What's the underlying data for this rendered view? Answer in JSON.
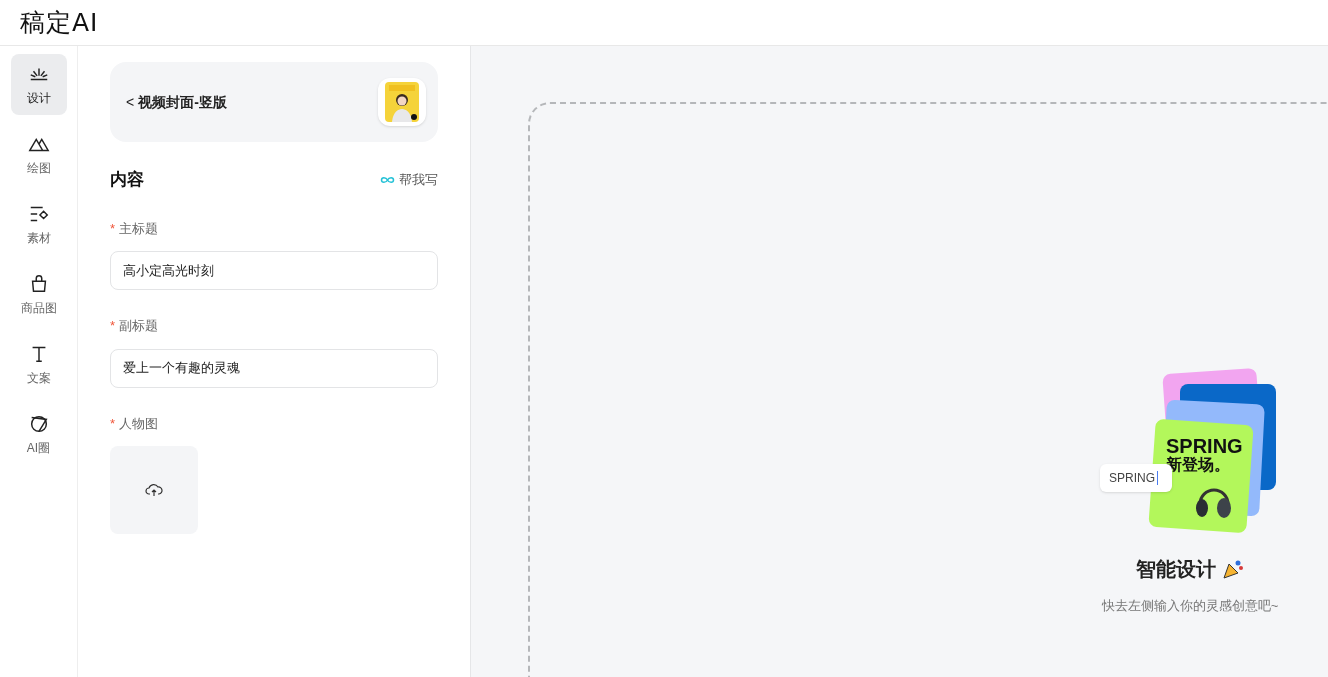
{
  "header": {
    "logo": "稿定AI"
  },
  "nav": [
    {
      "kind": "design",
      "label": "设计",
      "selected": true
    },
    {
      "kind": "draw",
      "label": "绘图",
      "selected": false
    },
    {
      "kind": "material",
      "label": "素材",
      "selected": false
    },
    {
      "kind": "product",
      "label": "商品图",
      "selected": false
    },
    {
      "kind": "text",
      "label": "文案",
      "selected": false
    },
    {
      "kind": "ai",
      "label": "AI圈",
      "selected": false
    }
  ],
  "template": {
    "back": "<",
    "title": "视频封面-竖版"
  },
  "section": {
    "title": "内容",
    "helper": "帮我写"
  },
  "fields": [
    {
      "kind": "text",
      "label": "主标题",
      "required_mark": "*",
      "value": "高小定高光时刻"
    },
    {
      "kind": "text",
      "label": "副标题",
      "required_mark": "*",
      "value": "爱上一个有趣的灵魂"
    },
    {
      "kind": "upload",
      "label": "人物图",
      "required_mark": "*"
    }
  ],
  "canvas": {
    "illustration": {
      "chip_text": "SPRING",
      "card_title": "SPRING",
      "card_subtitle": "新登场。"
    },
    "title": "智能设计",
    "subtitle": "快去左侧输入你的灵感创意吧~"
  }
}
